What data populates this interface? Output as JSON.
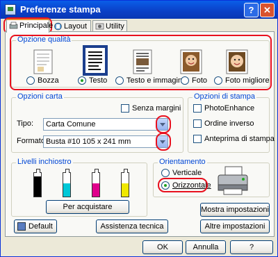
{
  "window": {
    "title": "Preferenze stampa",
    "help_glyph": "?",
    "close_glyph": "✕"
  },
  "tabs": [
    {
      "label": "Principale",
      "icon": "printer-icon",
      "active": true
    },
    {
      "label": "Layout",
      "icon": "layout-icon",
      "active": false
    },
    {
      "label": "Utility",
      "icon": "utility-icon",
      "active": false
    }
  ],
  "quality": {
    "title": "Opzione qualità",
    "options": [
      {
        "label": "Bozza",
        "icon": "draft-page-icon",
        "selected": false
      },
      {
        "label": "Testo",
        "icon": "text-page-icon",
        "selected": true
      },
      {
        "label": "Testo e immagine",
        "icon": "text-image-page-icon",
        "selected": false
      },
      {
        "label": "Foto",
        "icon": "photo-icon",
        "selected": false
      },
      {
        "label": "Foto migliore",
        "icon": "best-photo-icon",
        "selected": false
      }
    ]
  },
  "paper": {
    "title": "Opzioni carta",
    "borderless_label": "Senza margini",
    "type_label": "Tipo:",
    "type_value": "Carta Comune",
    "format_label": "Formato:",
    "format_value": "Busta #10 105 x 241 mm"
  },
  "print_options": {
    "title": "Opzioni di stampa",
    "items": [
      "PhotoEnhance",
      "Ordine inverso",
      "Anteprima di stampa"
    ]
  },
  "ink": {
    "title": "Livelli inchiostro",
    "cartridges": [
      {
        "color": "#000000",
        "level": 0.85
      },
      {
        "color": "#00c8d8",
        "level": 0.55
      },
      {
        "color": "#e0008c",
        "level": 0.55
      },
      {
        "color": "#f0e800",
        "level": 0.55
      }
    ],
    "buy_label": "Per acquistare"
  },
  "orientation": {
    "title": "Orientamento",
    "portrait_label": "Verticale",
    "landscape_label": "Orizzontale",
    "selected": "landscape"
  },
  "buttons": {
    "show_settings": "Mostra impostazioni",
    "default": "Default",
    "tech_support": "Assistenza tecnica",
    "other_settings": "Altre impostazioni",
    "ok": "OK",
    "cancel": "Annulla",
    "help": "?"
  },
  "colors": {
    "highlight": "#e8101e",
    "group_title": "#0046d5",
    "title_bar": "#0a5ee8"
  }
}
